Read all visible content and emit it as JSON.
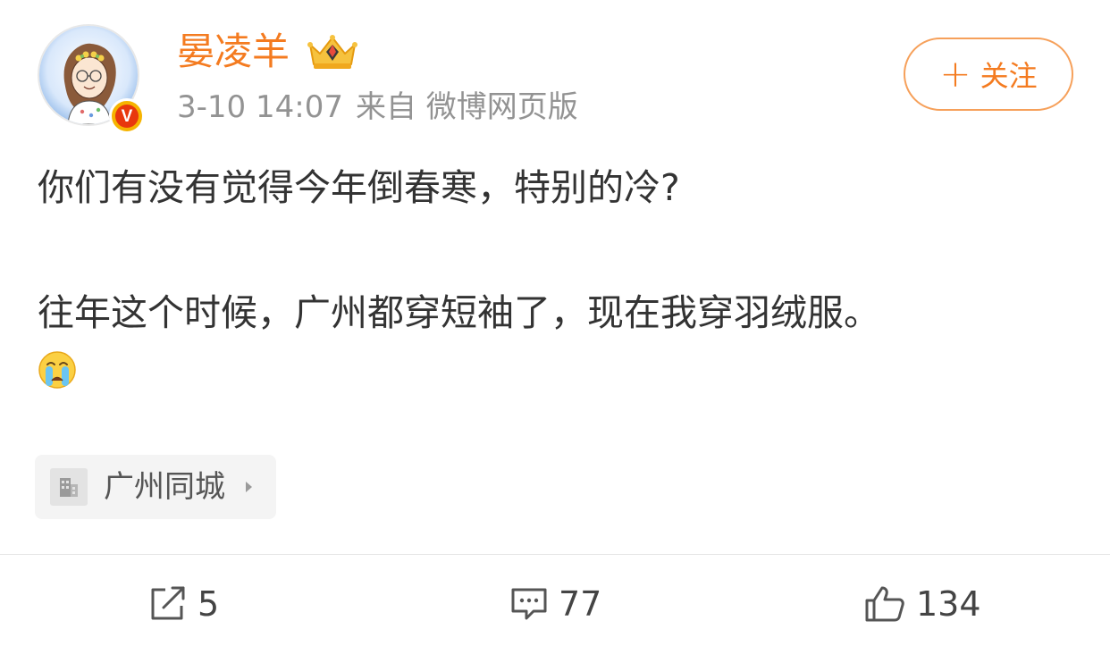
{
  "post": {
    "author": {
      "name": "晏凌羊",
      "verified_badge": "V",
      "avatar_icon": "cartoon-avatar-icon",
      "membership_icon": "crown-icon"
    },
    "meta": {
      "time": "3-10 14:07",
      "source": "来自 微博网页版"
    },
    "follow_button": {
      "plus": "+",
      "label": "关注"
    },
    "content": {
      "line1": "你们有没有觉得今年倒春寒，特别的冷?",
      "line2": "往年这个时候，广州都穿短袖了，现在我穿羽绒服。",
      "emoji": "crying-face-icon"
    },
    "location": {
      "label": "广州同城",
      "icon": "building-icon"
    },
    "actions": {
      "repost_count": "5",
      "comment_count": "77",
      "like_count": "134"
    }
  },
  "colors": {
    "accent_orange": "#f47b20",
    "follow_border": "#f6a05a",
    "text_primary": "#333333",
    "text_meta": "#939393",
    "verified_red": "#e8380d",
    "verified_gold": "#f6b400"
  }
}
